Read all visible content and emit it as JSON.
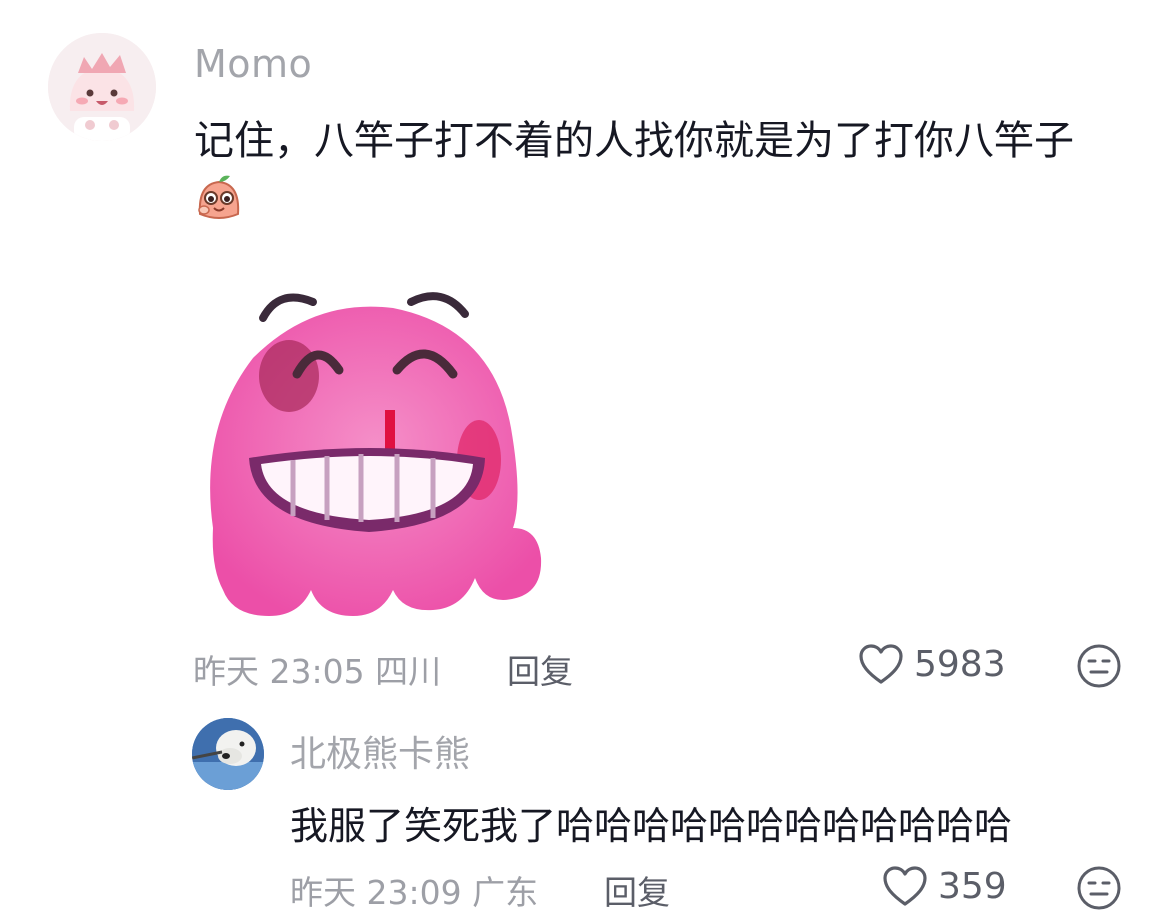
{
  "comments": [
    {
      "author": "Momo",
      "text": "记住，八竿子打不着的人找你就是为了打你八竿子",
      "inline_emoji": "smiling-peach-emoji",
      "sticker": "pink-grinning-blob-sticker",
      "time": "昨天 23:05",
      "location": "四川",
      "reply_label": "回复",
      "likes": "5983"
    }
  ],
  "replies": [
    {
      "author": "北极熊卡熊",
      "text": "我服了笑死我了哈哈哈哈哈哈哈哈哈哈哈哈",
      "time": "昨天 23:09",
      "location": "广东",
      "reply_label": "回复",
      "likes": "359"
    }
  ],
  "icons": {
    "like": "heart-outline-icon",
    "dislike": "meh-face-icon"
  },
  "colors": {
    "text_primary": "#161823",
    "text_secondary": "#a3a5ab",
    "icon": "#5b5e68"
  }
}
